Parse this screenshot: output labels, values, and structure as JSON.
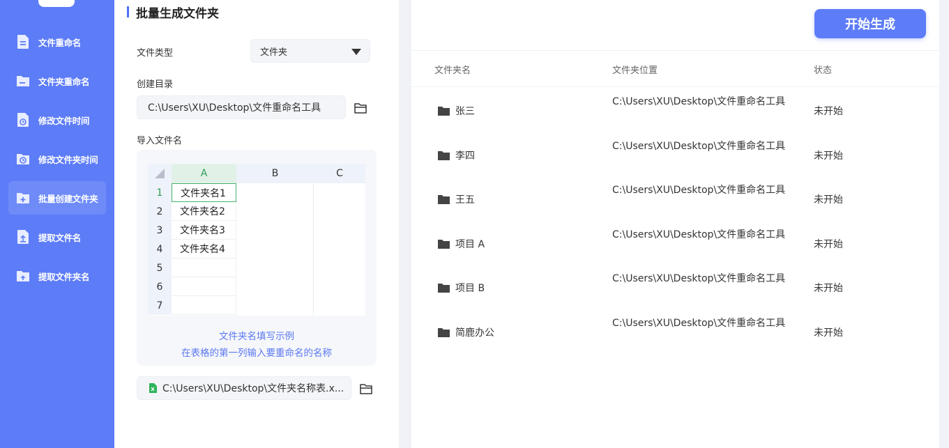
{
  "sidebar": {
    "items": [
      {
        "label": "文件重命名",
        "icon": "file-icon"
      },
      {
        "label": "文件夹重命名",
        "icon": "folder-icon"
      },
      {
        "label": "修改文件时间",
        "icon": "file-clock-icon"
      },
      {
        "label": "修改文件夹时间",
        "icon": "folder-clock-icon"
      },
      {
        "label": "批量创建文件夹",
        "icon": "folder-add-icon"
      },
      {
        "label": "提取文件名",
        "icon": "file-upload-icon"
      },
      {
        "label": "提取文件夹名",
        "icon": "folder-upload-icon"
      }
    ],
    "active_index": 4
  },
  "form": {
    "title": "批量生成文件夹",
    "type_label": "文件类型",
    "type_value": "文件夹",
    "dir_label": "创建目录",
    "dir_value": "C:\\Users\\XU\\Desktop\\文件重命名工具",
    "import_label": "导入文件名",
    "import_value": "C:\\Users\\XU\\Desktop\\文件夹名称表.x..."
  },
  "sheet": {
    "columns": [
      "A",
      "B",
      "C"
    ],
    "rows": [
      "1",
      "2",
      "3",
      "4",
      "5",
      "6",
      "7"
    ],
    "values": [
      "文件夹名1",
      "文件夹名2",
      "文件夹名3",
      "文件夹名4",
      "",
      "",
      ""
    ],
    "caption_line1": "文件夹名填写示例",
    "caption_line2": "在表格的第一列输入要重命名的名称"
  },
  "actions": {
    "start_label": "开始生成"
  },
  "table": {
    "headers": [
      "文件夹名",
      "文件夹位置",
      "状态"
    ],
    "rows": [
      {
        "name": "张三",
        "path": "C:\\Users\\XU\\Desktop\\文件重命名工具",
        "status": "未开始"
      },
      {
        "name": "李四",
        "path": "C:\\Users\\XU\\Desktop\\文件重命名工具",
        "status": "未开始"
      },
      {
        "name": "王五",
        "path": "C:\\Users\\XU\\Desktop\\文件重命名工具",
        "status": "未开始"
      },
      {
        "name": "项目 A",
        "path": "C:\\Users\\XU\\Desktop\\文件重命名工具",
        "status": "未开始"
      },
      {
        "name": "项目 B",
        "path": "C:\\Users\\XU\\Desktop\\文件重命名工具",
        "status": "未开始"
      },
      {
        "name": "简鹿办公",
        "path": "C:\\Users\\XU\\Desktop\\文件重命名工具",
        "status": "未开始"
      }
    ]
  },
  "colors": {
    "accent": "#5d7cf7",
    "excel_green": "#2fb35a"
  }
}
